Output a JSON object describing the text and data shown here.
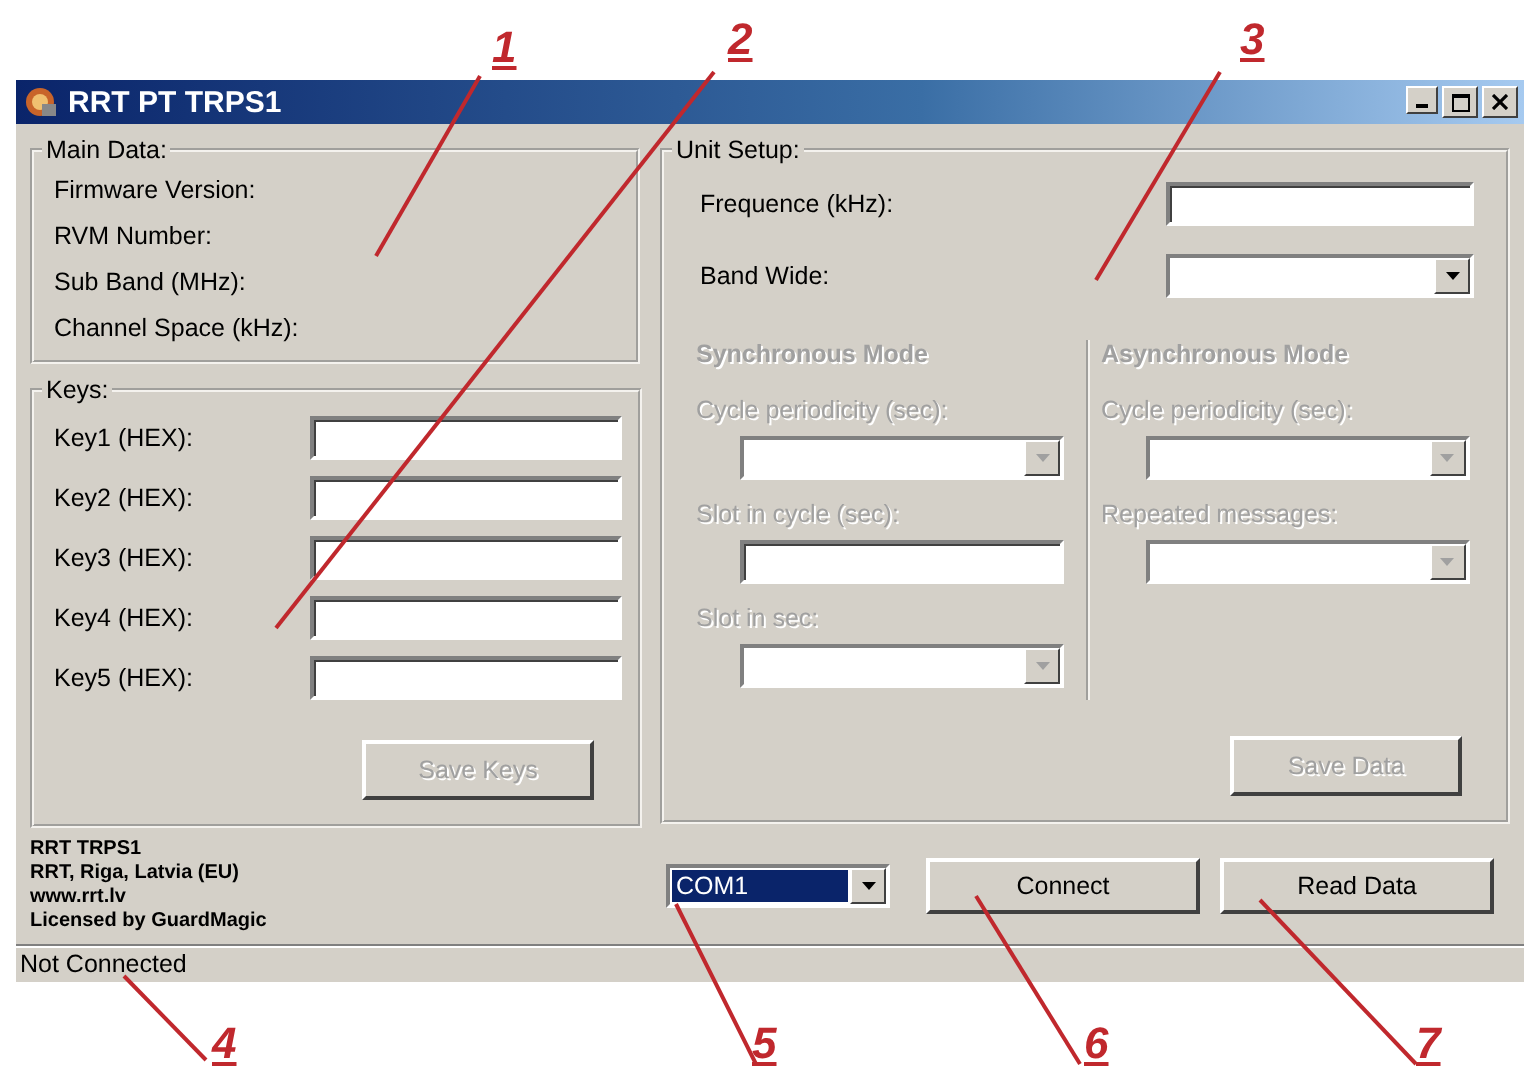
{
  "window": {
    "title": "RRT PT TRPS1"
  },
  "main_data": {
    "legend": "Main Data:",
    "labels": [
      "Firmware Version:",
      "RVM Number:",
      "Sub Band (MHz):",
      "Channel Space (kHz):"
    ]
  },
  "keys": {
    "legend": "Keys:",
    "rows": [
      {
        "label": "Key1 (HEX):"
      },
      {
        "label": "Key2 (HEX):"
      },
      {
        "label": "Key3 (HEX):"
      },
      {
        "label": "Key4 (HEX):"
      },
      {
        "label": "Key5 (HEX):"
      }
    ],
    "save_button": {
      "label": "Save Keys",
      "disabled": true
    }
  },
  "unit_setup": {
    "legend": "Unit Setup:",
    "fields": [
      {
        "label": "Frequence (kHz):",
        "kind": "text"
      },
      {
        "label": "Band Wide:",
        "kind": "combo"
      }
    ],
    "modes": [
      {
        "title": "Synchronous Mode",
        "disabled": true,
        "fields": [
          {
            "label": "Cycle periodicity (sec):",
            "kind": "combo"
          },
          {
            "label": "Slot in cycle (sec):",
            "kind": "text"
          },
          {
            "label": "Slot in sec:",
            "kind": "combo"
          }
        ]
      },
      {
        "title": "Asynchronous Mode",
        "disabled": true,
        "fields": [
          {
            "label": "Cycle periodicity (sec):",
            "kind": "combo"
          },
          {
            "label": "Repeated messages:",
            "kind": "combo"
          }
        ]
      }
    ],
    "save_button": {
      "label": "Save Data",
      "disabled": true
    }
  },
  "credits": [
    "RRT TRPS1",
    "RRT, Riga, Latvia (EU)",
    "www.rrt.lv",
    "Licensed by GuardMagic"
  ],
  "port": {
    "value": "COM1",
    "focused": true
  },
  "buttons": [
    {
      "label": "Connect"
    },
    {
      "label": "Read Data"
    }
  ],
  "status_bar": "Not Connected",
  "callouts": [
    {
      "label": "1"
    },
    {
      "label": "2"
    },
    {
      "label": "3"
    },
    {
      "label": "4"
    },
    {
      "label": "5"
    },
    {
      "label": "6"
    },
    {
      "label": "7"
    }
  ]
}
